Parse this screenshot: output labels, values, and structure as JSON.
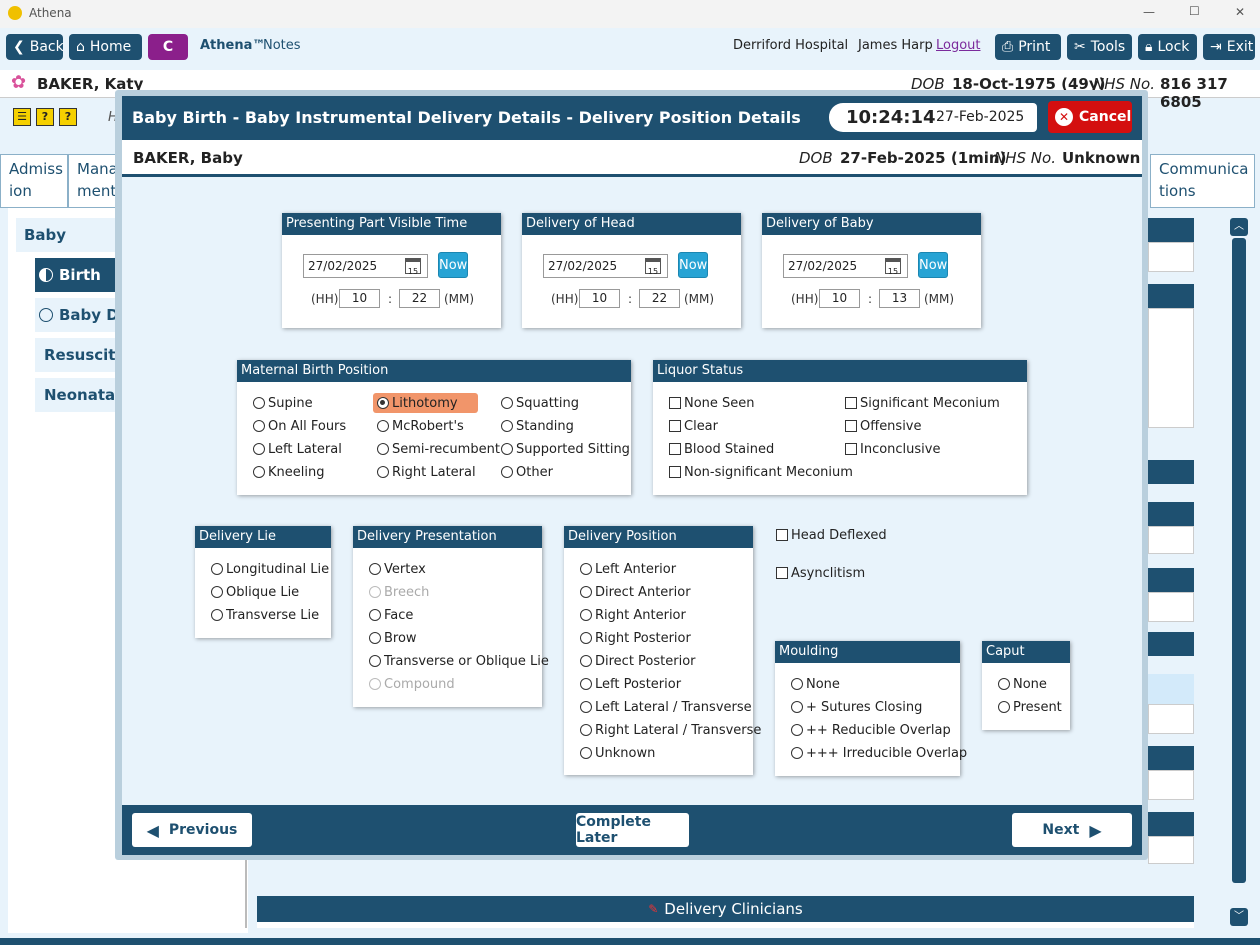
{
  "window": {
    "title": "Athena",
    "min": "—",
    "max": "☐",
    "close": "✕"
  },
  "nav": {
    "back": "Back",
    "home": "Home",
    "c_badge": "C",
    "app_name": "Athena™",
    "app_suffix": "Notes",
    "hospital": "Derriford Hospital",
    "user": "James Harp",
    "logout": "Logout",
    "print": "Print",
    "tools": "Tools",
    "lock": "Lock",
    "exit": "Exit"
  },
  "patient": {
    "name": "BAKER, Katy",
    "dob_label": "DOB",
    "dob": "18-Oct-1975 (49y)",
    "nhs_label": "NHS No.",
    "nhs": "816 317 6805"
  },
  "bg": {
    "h_letter": "H",
    "tab1": "Admiss ion",
    "tab2": "Mana ment",
    "tab_right": "Communica tions",
    "side_header": "Baby",
    "side_items": [
      "Birth",
      "Baby De",
      "Resuscitati",
      "Neonatal S"
    ],
    "delivery_clinicians": "Delivery Clinicians"
  },
  "modal": {
    "title": "Baby Birth - Baby Instrumental Delivery Details - Delivery Position Details",
    "time": "10:24:14",
    "date": "27-Feb-2025",
    "cancel": "Cancel",
    "baby_name": "BAKER, Baby",
    "dob_label": "DOB",
    "dob": "27-Feb-2025 (1min)",
    "nhs_label": "NHS No.",
    "nhs": "Unknown",
    "times": [
      {
        "title": "Presenting Part Visible Time",
        "date": "27/02/2025",
        "hh": "10",
        "mm": "22"
      },
      {
        "title": "Delivery of Head",
        "date": "27/02/2025",
        "hh": "10",
        "mm": "22"
      },
      {
        "title": "Delivery of Baby",
        "date": "27/02/2025",
        "hh": "10",
        "mm": "13"
      }
    ],
    "now": "Now",
    "hh_label": "(HH)",
    "mm_label": "(MM)",
    "colon": ":",
    "cal_day": "15",
    "maternal": {
      "title": "Maternal Birth Position",
      "options": [
        "Supine",
        "On All Fours",
        "Left Lateral",
        "Kneeling",
        "Lithotomy",
        "McRobert's",
        "Semi-recumbent",
        "Right Lateral",
        "Squatting",
        "Standing",
        "Supported Sitting",
        "Other"
      ],
      "selected": "Lithotomy"
    },
    "liquor": {
      "title": "Liquor Status",
      "options": [
        "None Seen",
        "Clear",
        "Blood Stained",
        "Non-significant Meconium",
        "Significant Meconium",
        "Offensive",
        "Inconclusive"
      ]
    },
    "lie": {
      "title": "Delivery Lie",
      "options": [
        "Longitudinal Lie",
        "Oblique Lie",
        "Transverse Lie"
      ]
    },
    "presentation": {
      "title": "Delivery Presentation",
      "options": [
        "Vertex",
        "Breech",
        "Face",
        "Brow",
        "Transverse or Oblique Lie",
        "Compound"
      ],
      "disabled": [
        "Breech",
        "Compound"
      ]
    },
    "position": {
      "title": "Delivery Position",
      "options": [
        "Left Anterior",
        "Direct Anterior",
        "Right Anterior",
        "Right Posterior",
        "Direct Posterior",
        "Left Posterior",
        "Left Lateral / Transverse",
        "Right Lateral / Transverse",
        "Unknown"
      ]
    },
    "head_deflexed": "Head Deflexed",
    "asynclitism": "Asynclitism",
    "moulding": {
      "title": "Moulding",
      "options": [
        "None",
        "+ Sutures Closing",
        "++ Reducible Overlap",
        "+++ Irreducible Overlap"
      ]
    },
    "caput": {
      "title": "Caput",
      "options": [
        "None",
        "Present"
      ]
    },
    "previous": "Previous",
    "complete_later": "Complete Later",
    "next": "Next"
  }
}
